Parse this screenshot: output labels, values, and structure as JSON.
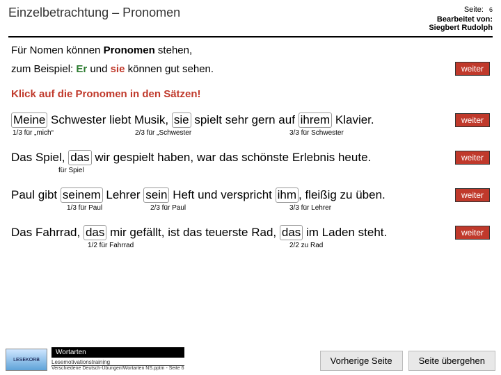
{
  "header": {
    "title": "Einzelbetrachtung – Pronomen",
    "page_label": "Seite:",
    "page_num": "6",
    "edited_label": "Bearbeitet von:",
    "author": "Siegbert Rudolph"
  },
  "intro": {
    "line1_pre": "Für Nomen können ",
    "line1_bold": "Pronomen",
    "line1_post": " stehen,",
    "line2_pre": "zum Beispiel: ",
    "line2_er": "Er",
    "line2_mid": " und ",
    "line2_sie": "sie",
    "line2_post": " können gut sehen.",
    "instruction_pre": "Klick",
    "instruction_post": " auf die Pronomen in den Sätzen!"
  },
  "weiter": "weiter",
  "sentences": [
    {
      "parts": [
        "Meine",
        " Schwester liebt Musik, ",
        "sie",
        " spielt sehr gern auf ",
        "ihrem",
        " Klavier."
      ],
      "boxes": [
        0,
        2,
        4
      ],
      "hints": [
        "1/3 für „mich“",
        "2/3 für „Schwester",
        "3/3 für Schwester"
      ]
    },
    {
      "parts": [
        "Das Spiel, ",
        "das",
        " wir gespielt haben, war das schönste Erlebnis heute."
      ],
      "boxes": [
        1
      ],
      "hints": [
        "für Spiel"
      ]
    },
    {
      "parts": [
        "Paul gibt ",
        "seinem",
        " Lehrer ",
        "sein",
        " Heft und verspricht ",
        "ihm",
        ", fleißig zu üben."
      ],
      "boxes": [
        1,
        3,
        5
      ],
      "hints": [
        "1/3 für Paul",
        "2/3 für Paul",
        "3/3 für Lehrer"
      ]
    },
    {
      "parts": [
        "Das Fahrrad, ",
        "das",
        " mir gefällt, ist das teuerste Rad, ",
        "das",
        " im Laden steht."
      ],
      "boxes": [
        1,
        3
      ],
      "hints": [
        "1/2 für Fahrrad",
        "2/2 zu Rad"
      ]
    }
  ],
  "footer": {
    "logo": "LESEKORB",
    "wortarten": "Wortarten",
    "tiny1": "Lesemotivationstraining",
    "tiny2": "Verschiedene Deutsch-Übungen\\Wortarten NS.pptm - Seite 6",
    "prev": "Vorherige Seite",
    "skip": "Seite übergehen"
  }
}
